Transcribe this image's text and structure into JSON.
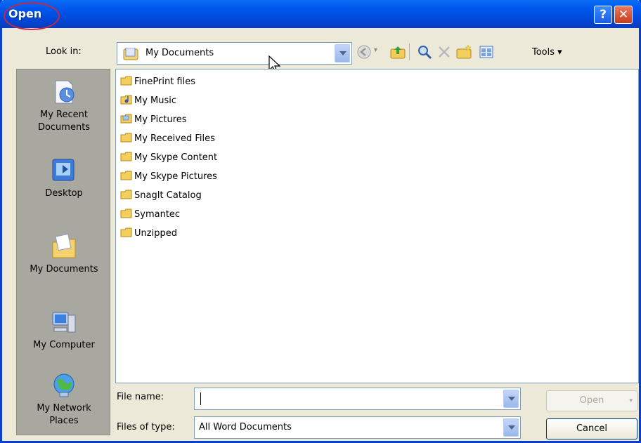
{
  "window": {
    "title": "Open"
  },
  "titlebar": {
    "help_glyph": "?",
    "close_glyph": "✕"
  },
  "lookin": {
    "label": "Look in:",
    "value": "My Documents",
    "toolbar": [
      "back-icon",
      "up-folder-icon",
      "search-web-icon",
      "delete-icon",
      "new-folder-icon",
      "views-icon"
    ],
    "tools_label": "Tools ▾"
  },
  "places": [
    {
      "label": "My Recent Documents",
      "icon": "recent-documents-icon"
    },
    {
      "label": "Desktop",
      "icon": "desktop-icon"
    },
    {
      "label": "My Documents",
      "icon": "my-documents-icon"
    },
    {
      "label": "My Computer",
      "icon": "my-computer-icon"
    },
    {
      "label": "My Network Places",
      "icon": "network-places-icon"
    }
  ],
  "files": [
    {
      "name": "FinePrint files",
      "icon": "folder-icon"
    },
    {
      "name": "My Music",
      "icon": "music-folder-icon"
    },
    {
      "name": "My Pictures",
      "icon": "pictures-folder-icon"
    },
    {
      "name": "My Received Files",
      "icon": "folder-icon"
    },
    {
      "name": "My Skype Content",
      "icon": "folder-icon"
    },
    {
      "name": "My Skype Pictures",
      "icon": "folder-icon"
    },
    {
      "name": "SnagIt Catalog",
      "icon": "folder-icon"
    },
    {
      "name": "Symantec",
      "icon": "folder-icon"
    },
    {
      "name": "Unzipped",
      "icon": "folder-icon"
    }
  ],
  "filename": {
    "label": "File name:",
    "value": ""
  },
  "filetype": {
    "label": "Files of type:",
    "value": "All Word Documents"
  },
  "buttons": {
    "open": "Open",
    "cancel": "Cancel"
  },
  "colors": {
    "titlebar": "#0058ee",
    "dialog_bg": "#ece9d8",
    "places_bg": "#a8a7a0",
    "accent_circle": "#c8283c"
  }
}
